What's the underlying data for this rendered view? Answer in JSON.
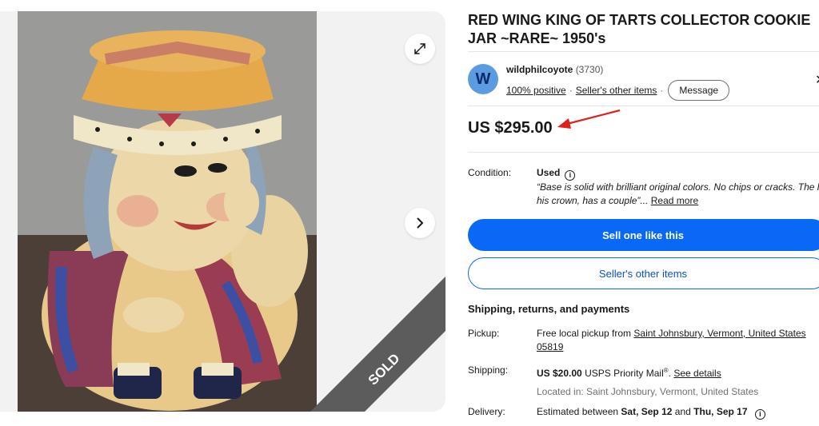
{
  "gallery": {
    "sold_label": "SOLD"
  },
  "listing": {
    "title": "RED WING KING OF TARTS COLLECTOR COOKIE JAR ~RARE~ 1950's",
    "price": "US $295.00"
  },
  "seller": {
    "avatar_letter": "W",
    "name": "wildphilcoyote",
    "score": "(3730)",
    "positive": "100% positive",
    "other_items": "Seller's other items",
    "message": "Message"
  },
  "condition": {
    "label": "Condition:",
    "value": "Used",
    "desc_line1": "“Base is solid with brilliant original colors. No chips or cracks. The li",
    "desc_line2": "his crown, has a couple”...",
    "read_more": "Read more"
  },
  "actions": {
    "sell_one": "Sell one like this",
    "sellers_items": "Seller's other items"
  },
  "shipping": {
    "heading": "Shipping, returns, and payments",
    "pickup_label": "Pickup:",
    "pickup_text": "Free local pickup from",
    "pickup_location_1": "Saint Johnsbury, Vermont, United States",
    "pickup_location_2": "05819",
    "shipping_label": "Shipping:",
    "shipping_cost": "US $20.00",
    "shipping_service": "USPS Priority Mail",
    "shipping_reg": "®",
    "see_details": "See details",
    "located_in": "Located in: Saint Johnsbury, Vermont, United States",
    "delivery_label": "Delivery:",
    "delivery_prefix": "Estimated between",
    "delivery_start": "Sat, Sep 12",
    "delivery_and": "and",
    "delivery_end": "Thu, Sep 17"
  },
  "icons": {
    "expand": "expand-icon",
    "next": "chevron-right-icon",
    "info": "info-icon",
    "close": "close-icon",
    "arrow": "red-arrow-annotation"
  },
  "colors": {
    "primary": "#0968f6",
    "arrow": "#e0201b"
  }
}
